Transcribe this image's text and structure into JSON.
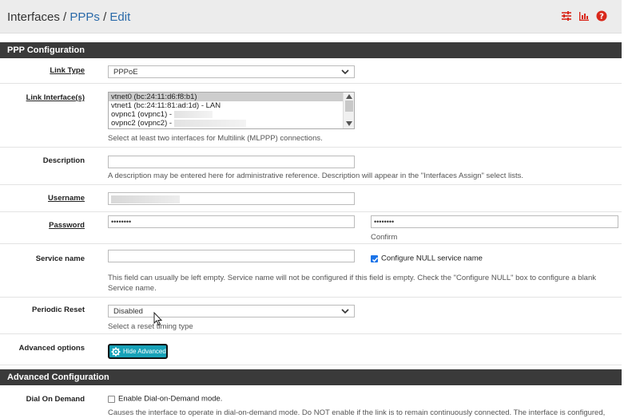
{
  "breadcrumb": {
    "first": "Interfaces",
    "second": "PPPs",
    "third": "Edit",
    "sep": "/"
  },
  "top_icons": [
    "sliders-icon",
    "bar-chart-icon",
    "help-icon"
  ],
  "ppp_heading": "PPP Configuration",
  "link_type": {
    "label": "Link Type",
    "value": "PPPoE"
  },
  "link_interfaces": {
    "label": "Link Interface(s)",
    "options": [
      "vtnet0 (bc:24:11:d6:f8:b1)",
      "vtnet1 (bc:24:11:81:ad:1d) - LAN",
      "ovpnc1 (ovpnc1) -",
      "ovpnc2 (ovpnc2) -"
    ],
    "help": "Select at least two interfaces for Multilink (MLPPP) connections."
  },
  "description": {
    "label": "Description",
    "value": "",
    "help": "A description may be entered here for administrative reference. Description will appear in the \"Interfaces Assign\" select lists."
  },
  "username": {
    "label": "Username"
  },
  "password": {
    "label": "Password",
    "value": "••••••••",
    "confirm_value": "••••••••",
    "confirm_label": "Confirm"
  },
  "service_name": {
    "label": "Service name",
    "value": "",
    "null_label": "Configure NULL service name",
    "help_line1": "This field can usually be left empty. Service name will not be configured if this field is empty. Check the \"Configure NULL\" box to configure a blank",
    "help_line2": "Service name."
  },
  "periodic_reset": {
    "label": "Periodic Reset",
    "value": "Disabled",
    "help": "Select a reset timing type"
  },
  "advanced_options": {
    "label": "Advanced options",
    "button": "Hide Advanced"
  },
  "advanced_heading": "Advanced Configuration",
  "dial_on_demand": {
    "label": "Dial On Demand",
    "checkbox_label": "Enable Dial-on-Demand mode.",
    "help": "Causes the interface to operate in dial-on-demand mode. Do NOT enable if the link is to remain continuously connected. The interface is configured,"
  },
  "colors": {
    "link": "#2a6aa9",
    "heading_bg": "#3a3a3a",
    "button": "#17a2b8",
    "danger": "#d9281b",
    "checkbox": "#1a73e8"
  }
}
